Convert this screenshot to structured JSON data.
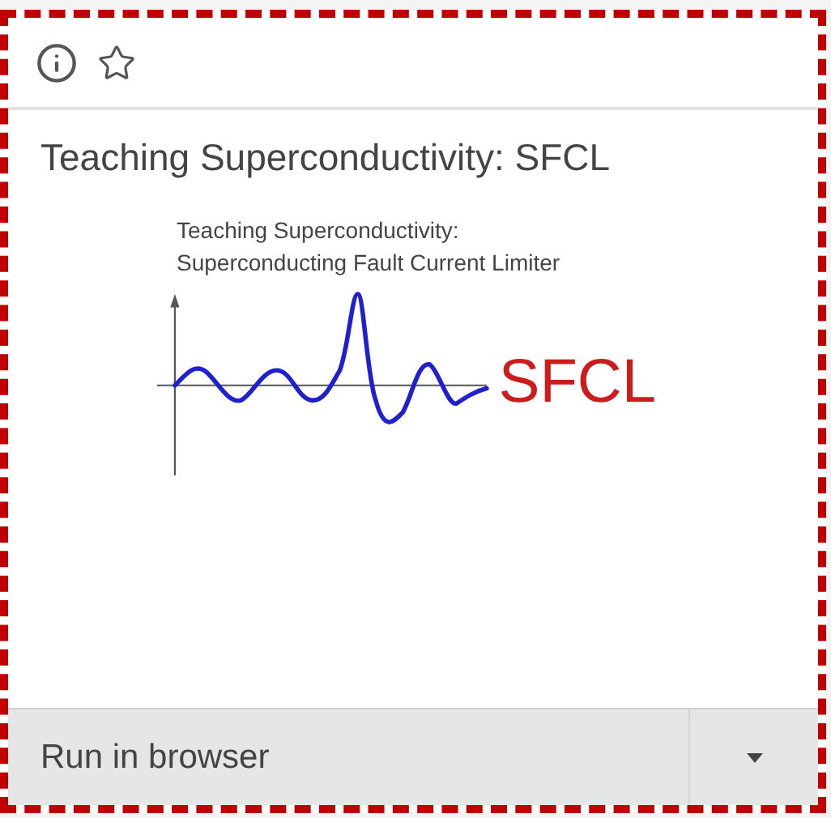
{
  "card": {
    "selected": true,
    "title": "Teaching Superconductivity: SFCL",
    "thumbnail": {
      "caption": [
        "Teaching Superconductivity:",
        "Superconducting Fault Current Limiter"
      ],
      "logo": "SFCL"
    },
    "action": {
      "label": "Run in browser"
    }
  }
}
